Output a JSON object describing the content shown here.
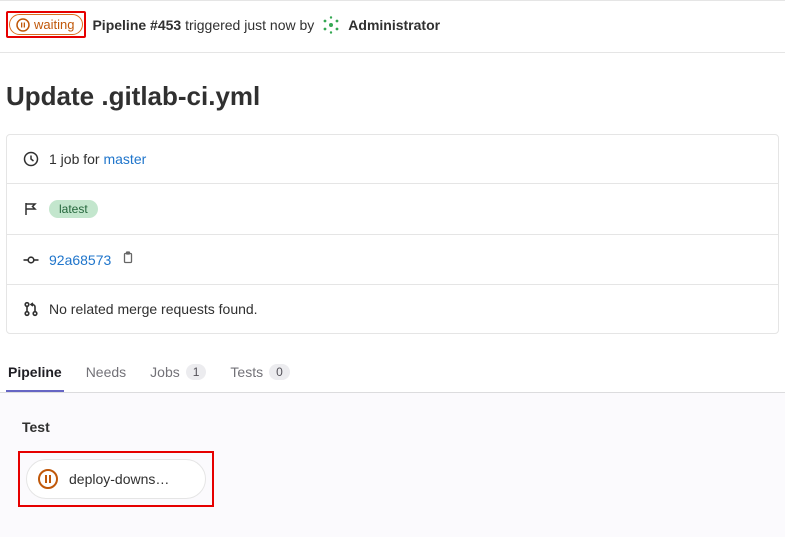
{
  "header": {
    "status": "waiting",
    "pipeline_label_prefix": "Pipeline ",
    "pipeline_number": "#453",
    "triggered_text": " triggered just now by",
    "user": "Administrator"
  },
  "title": "Update .gitlab-ci.yml",
  "info": {
    "jobs_text_prefix": "1 job for ",
    "branch": "master",
    "tag": "latest",
    "commit_sha": "92a68573",
    "mr_text": "No related merge requests found."
  },
  "tabs": {
    "pipeline": "Pipeline",
    "needs": "Needs",
    "jobs": "Jobs",
    "jobs_count": "1",
    "tests": "Tests",
    "tests_count": "0"
  },
  "stage": {
    "name": "Test",
    "job_name": "deploy-downs…"
  }
}
